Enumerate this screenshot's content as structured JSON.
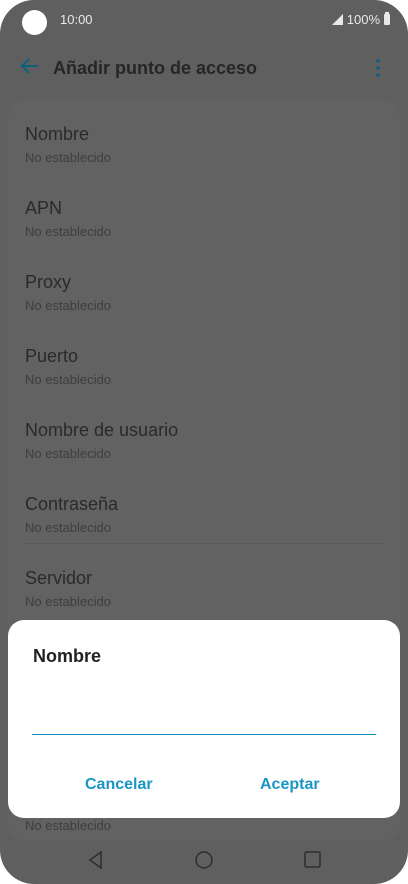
{
  "status_bar": {
    "time": "10:00",
    "battery": "100%"
  },
  "header": {
    "title": "Añadir punto de acceso"
  },
  "settings": [
    {
      "label": "Nombre",
      "value": "No establecido"
    },
    {
      "label": "APN",
      "value": "No establecido"
    },
    {
      "label": "Proxy",
      "value": "No establecido"
    },
    {
      "label": "Puerto",
      "value": "No establecido"
    },
    {
      "label": "Nombre de usuario",
      "value": "No establecido"
    },
    {
      "label": "Contraseña",
      "value": "No establecido"
    },
    {
      "label": "Servidor",
      "value": "No establecido"
    }
  ],
  "behind_dialog_text": "No establecido",
  "dialog": {
    "title": "Nombre",
    "input_value": "",
    "cancel_label": "Cancelar",
    "accept_label": "Aceptar"
  },
  "colors": {
    "accent": "#1a95c4",
    "overlay": "#5f5f5f"
  }
}
